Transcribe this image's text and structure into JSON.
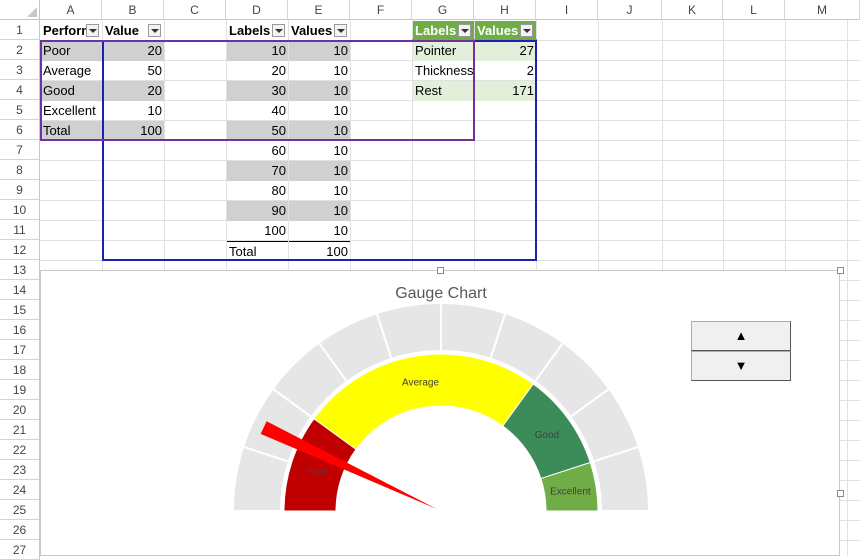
{
  "columns": [
    "A",
    "B",
    "C",
    "D",
    "E",
    "F",
    "G",
    "H",
    "I",
    "J",
    "K",
    "L",
    "M"
  ],
  "rows": [
    "1",
    "2",
    "3",
    "4",
    "5",
    "6",
    "7",
    "8",
    "9",
    "10",
    "11",
    "12",
    "13",
    "14",
    "15",
    "16",
    "17",
    "18",
    "19",
    "20",
    "21",
    "22",
    "23",
    "24",
    "25",
    "26",
    "27"
  ],
  "table1": {
    "headers": [
      "Perform",
      "Value"
    ],
    "rows": [
      {
        "label": "Poor",
        "value": "20"
      },
      {
        "label": "Average",
        "value": "50"
      },
      {
        "label": "Good",
        "value": "20"
      },
      {
        "label": "Excellent",
        "value": "10"
      },
      {
        "label": "Total",
        "value": "100"
      }
    ]
  },
  "table2": {
    "headers": [
      "Labels",
      "Values"
    ],
    "rows": [
      {
        "label": "10",
        "value": "10"
      },
      {
        "label": "20",
        "value": "10"
      },
      {
        "label": "30",
        "value": "10"
      },
      {
        "label": "40",
        "value": "10"
      },
      {
        "label": "50",
        "value": "10"
      },
      {
        "label": "60",
        "value": "10"
      },
      {
        "label": "70",
        "value": "10"
      },
      {
        "label": "80",
        "value": "10"
      },
      {
        "label": "90",
        "value": "10"
      },
      {
        "label": "100",
        "value": "10"
      },
      {
        "label": "Total",
        "value": "100"
      }
    ]
  },
  "table3": {
    "headers": [
      "Labels",
      "Values"
    ],
    "rows": [
      {
        "label": "Pointer",
        "value": "27"
      },
      {
        "label": "Thickness",
        "value": "2"
      },
      {
        "label": "Rest",
        "value": "171"
      }
    ]
  },
  "chart_data": {
    "type": "gauge",
    "title": "Gauge Chart",
    "outer_ring": {
      "values": [
        10,
        10,
        10,
        10,
        10,
        10,
        10,
        10,
        10,
        10
      ],
      "color": "#e6e6e6"
    },
    "inner_ring": {
      "categories": [
        "Poor",
        "Average",
        "Good",
        "Excellent"
      ],
      "values": [
        20,
        50,
        20,
        10
      ],
      "colors": [
        "#c00000",
        "#ffff00",
        "#3c8c5a",
        "#70ad47"
      ]
    },
    "pointer": {
      "value": 27,
      "thickness": 2,
      "rest": 171,
      "color": "#ff0000"
    }
  },
  "spinner": {
    "up_label": "▲",
    "down_label": "▼"
  },
  "colors": {
    "border_purple": "#7030a0",
    "border_blue": "#1f1fb4",
    "table_green": "#70ad47"
  }
}
